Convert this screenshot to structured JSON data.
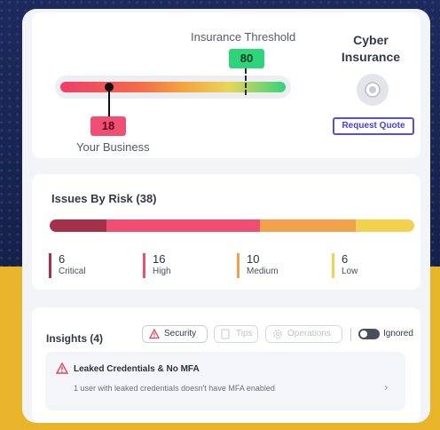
{
  "threshold": {
    "label": "Insurance Threshold",
    "value": "80"
  },
  "business": {
    "label": "Your Business",
    "value": "18"
  },
  "cyber": {
    "title_line1": "Cyber",
    "title_line2": "Insurance",
    "button": "Request Quote"
  },
  "issues": {
    "title": "Issues By Risk (38)",
    "stats": [
      {
        "count": "6",
        "label": "Critical",
        "color": "#a5304a"
      },
      {
        "count": "16",
        "label": "High",
        "color": "#ef4d72"
      },
      {
        "count": "10",
        "label": "Medium",
        "color": "#f2a14a"
      },
      {
        "count": "6",
        "label": "Low",
        "color": "#f1d14e"
      }
    ]
  },
  "insights": {
    "title": "Insights (4)",
    "filters": [
      "Security",
      "Tips",
      "Operations"
    ],
    "ignored_label": "Ignored",
    "item": {
      "title": "Leaked Credentials & No MFA",
      "description": "1 user with leaked credentials doesn't have MFA enabled"
    }
  }
}
